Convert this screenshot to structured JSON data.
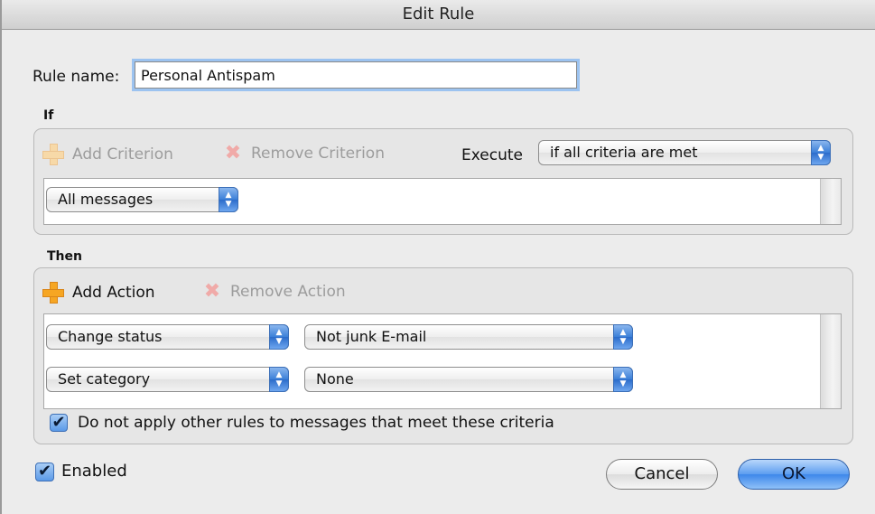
{
  "window": {
    "title": "Edit Rule"
  },
  "rule_name": {
    "label": "Rule name:",
    "value": "Personal Antispam"
  },
  "if_section": {
    "heading": "If",
    "add_criterion": "Add Criterion",
    "remove_criterion": "Remove Criterion",
    "execute_label": "Execute",
    "execute_value": "if all criteria are met",
    "criteria": [
      {
        "value": "All messages"
      }
    ]
  },
  "then_section": {
    "heading": "Then",
    "add_action": "Add Action",
    "remove_action": "Remove Action",
    "actions": [
      {
        "action": "Change status",
        "value": "Not junk E-mail"
      },
      {
        "action": "Set category",
        "value": "None"
      }
    ],
    "stop_rules_label": "Do not apply other rules to messages that meet these criteria",
    "stop_rules_checked": true
  },
  "footer": {
    "enabled_label": "Enabled",
    "enabled_checked": true,
    "cancel_label": "Cancel",
    "ok_label": "OK"
  },
  "icons": {
    "add": "plus-icon",
    "remove": "x-icon",
    "checkmark": "✔",
    "popup_arrows": "▲▼"
  },
  "colors": {
    "accent": "#3d87ea",
    "focus_ring": "#9cc3f0",
    "add_icon": "#f6a623",
    "remove_icon": "#d9534f"
  }
}
